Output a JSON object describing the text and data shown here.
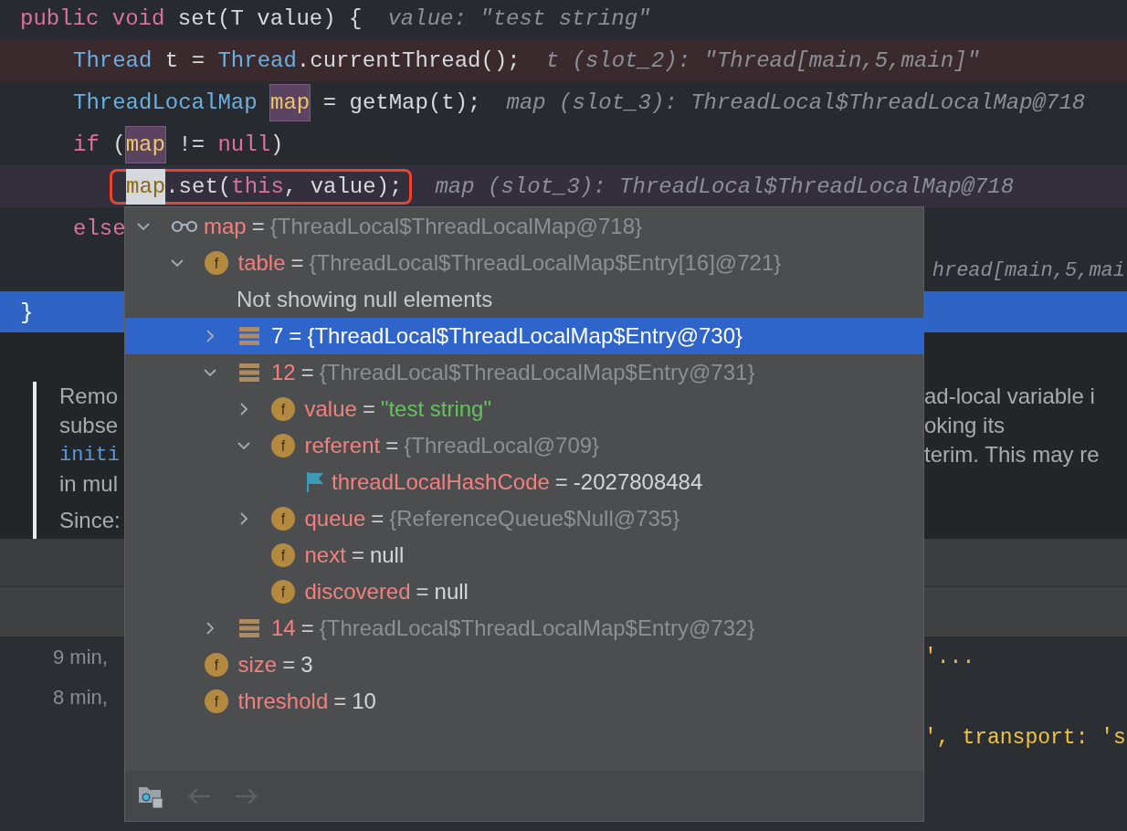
{
  "editor": {
    "lines": [
      {
        "tokens": [
          {
            "text": "public void ",
            "kind": "keyword"
          },
          {
            "text": "set(T value) {",
            "kind": "plain"
          }
        ],
        "hint": "value: \"test string\"",
        "children": [
          {
            "tokens": [
              {
                "text": "Thread",
                "kind": "type"
              },
              {
                "text": " t = ",
                "kind": "plain"
              },
              {
                "text": "Thread",
                "kind": "type"
              },
              {
                "text": ".currentThread();",
                "kind": "plain"
              }
            ],
            "hint": "t (slot_2): \"Thread[main,5,main]\"",
            "kind": "breakpoint"
          },
          {
            "tokens": [
              {
                "text": "ThreadLocalMap ",
                "kind": "type"
              },
              {
                "text": "map",
                "kind": "var"
              },
              {
                "text": " = getMap(t);",
                "kind": "plain"
              }
            ],
            "hint": "map (slot_3): ThreadLocal$ThreadLocalMap@718"
          },
          {
            "tokens": [
              {
                "text": "if",
                "kind": "keyword"
              },
              {
                "text": " (",
                "kind": "plain"
              },
              {
                "text": "map",
                "kind": "var"
              },
              {
                "text": " != ",
                "kind": "plain"
              },
              {
                "text": "null",
                "kind": "keyword"
              },
              {
                "text": ")",
                "kind": "plain"
              }
            ],
            "children": [
              {
                "tokens": [
                  {
                    "text": "map",
                    "kind": "var-caret"
                  },
                  {
                    "text": ".set(",
                    "kind": "plain"
                  },
                  {
                    "text": "this",
                    "kind": "keyword"
                  },
                  {
                    "text": ", value);",
                    "kind": "plain"
                  }
                ],
                "hint": "map (slot_3): ThreadLocal$ThreadLocalMap@718",
                "kind": "hover",
                "outlined": true
              }
            ]
          },
          {
            "tokens": [
              {
                "text": "else",
                "kind": "keyword"
              }
            ],
            "children": [
              {
                "hint": "hread[main,5,mai"
              }
            ]
          }
        ]
      },
      {
        "tokens": [
          {
            "text": "}",
            "kind": "plain"
          }
        ],
        "kind": "current"
      }
    ]
  },
  "documentation": {
    "lines": [
      {
        "left": "Remo",
        "right": "ad-local variable i"
      },
      {
        "left": "subse",
        "right": "oking its"
      },
      {
        "left": "initi",
        "kind": "code",
        "right": "terim. This may re"
      },
      {
        "left": "in mul"
      },
      {
        "left": "Since:"
      }
    ]
  },
  "console": {
    "lines": [
      {
        "left": "9 min,",
        "right": "'..."
      },
      {
        "left": "8 min,"
      },
      {
        "right": "', transport: 's"
      }
    ]
  },
  "popup": {
    "tree": [
      {
        "kind": "watch",
        "name": "map",
        "operator": "=",
        "value": "{ThreadLocal$ThreadLocalMap@718}",
        "dimmed": true,
        "string": false,
        "expanded": true,
        "selected": false,
        "children": [
          {
            "kind": "field",
            "badge": "f",
            "name": "table",
            "operator": "=",
            "value": "{ThreadLocal$ThreadLocalMap$Entry[16]@721}",
            "dimmed": true,
            "string": false,
            "expanded": true,
            "selected": false,
            "children": [
              {
                "kind": "note",
                "text": "Not showing null elements",
                "selected": false
              },
              {
                "kind": "entry",
                "name": "7",
                "operator": "=",
                "value": "{ThreadLocal$ThreadLocalMap$Entry@730}",
                "dimmed": true,
                "string": false,
                "expanded": false,
                "selected": true
              },
              {
                "kind": "entry",
                "name": "12",
                "operator": "=",
                "value": "{ThreadLocal$ThreadLocalMap$Entry@731}",
                "dimmed": true,
                "string": false,
                "expanded": true,
                "selected": false,
                "children": [
                  {
                    "kind": "field",
                    "badge": "f",
                    "name": "value",
                    "operator": "=",
                    "value": "\"test string\"",
                    "dimmed": false,
                    "string": true,
                    "expanded": false,
                    "selected": false
                  },
                  {
                    "kind": "field",
                    "badge": "f",
                    "name": "referent",
                    "operator": "=",
                    "value": "{ThreadLocal@709}",
                    "dimmed": true,
                    "string": false,
                    "expanded": true,
                    "selected": false,
                    "children": [
                      {
                        "kind": "static",
                        "name": "threadLocalHashCode",
                        "operator": "=",
                        "value": "-2027808484",
                        "dimmed": false,
                        "string": false,
                        "selected": false
                      }
                    ]
                  },
                  {
                    "kind": "field",
                    "badge": "f",
                    "name": "queue",
                    "operator": "=",
                    "value": "{ReferenceQueue$Null@735}",
                    "dimmed": true,
                    "string": false,
                    "expanded": false,
                    "selected": false
                  },
                  {
                    "kind": "field",
                    "badge": "f",
                    "name": "next",
                    "operator": "=",
                    "value": "null",
                    "dimmed": false,
                    "string": false,
                    "selected": false
                  },
                  {
                    "kind": "field",
                    "badge": "f",
                    "name": "discovered",
                    "operator": "=",
                    "value": "null",
                    "dimmed": false,
                    "string": false,
                    "selected": false
                  }
                ]
              },
              {
                "kind": "entry",
                "name": "14",
                "operator": "=",
                "value": "{ThreadLocal$ThreadLocalMap$Entry@732}",
                "dimmed": true,
                "string": false,
                "expanded": false,
                "selected": false
              }
            ]
          },
          {
            "kind": "field",
            "badge": "f",
            "name": "size",
            "operator": "=",
            "value": "3",
            "dimmed": false,
            "string": false,
            "selected": false
          },
          {
            "kind": "field",
            "badge": "f",
            "name": "threshold",
            "operator": "=",
            "value": "10",
            "dimmed": false,
            "string": false,
            "selected": false
          }
        ]
      }
    ],
    "toolbar": [
      {
        "kind": "folder",
        "disabled": false
      },
      {
        "kind": "back",
        "disabled": true
      },
      {
        "kind": "forward",
        "disabled": true
      }
    ]
  }
}
